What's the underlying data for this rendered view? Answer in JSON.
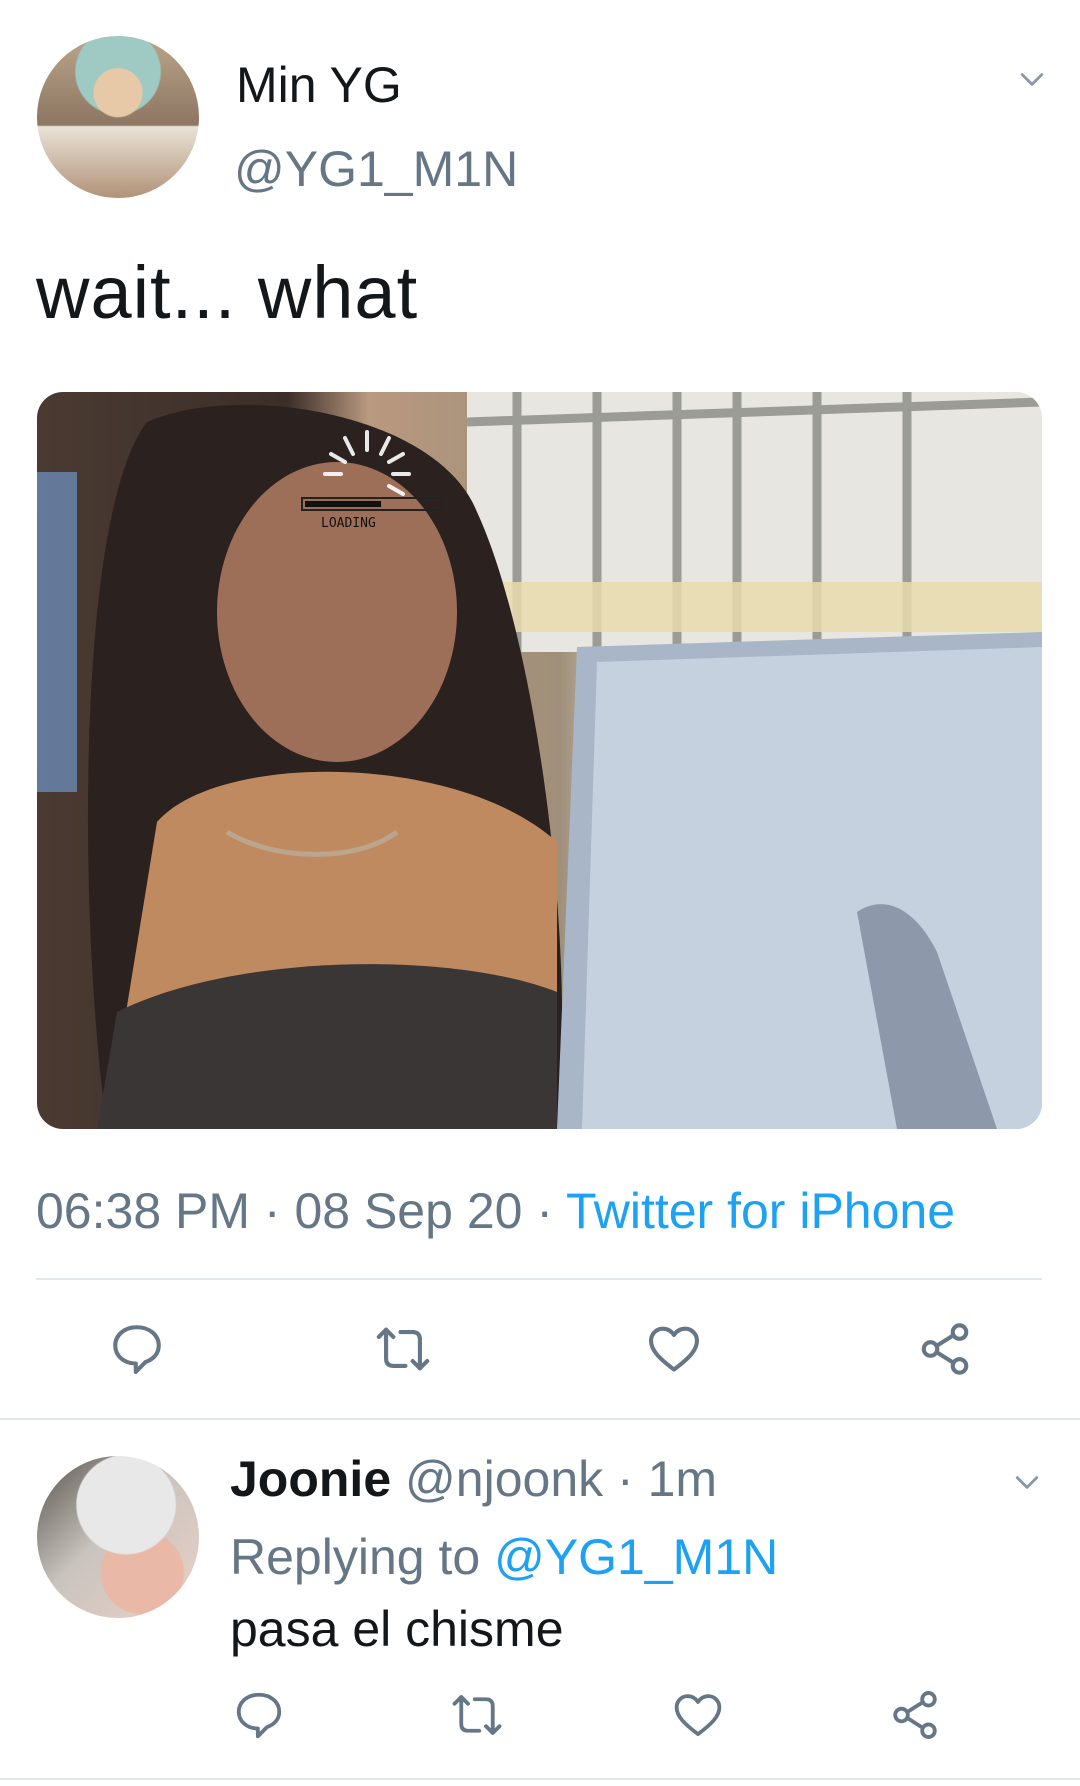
{
  "tweet": {
    "author_name": "Min YG",
    "author_handle": "@YG1_M1N",
    "text": "wait... what",
    "media_overlay_label": "LOADING",
    "time": "06:38 PM",
    "date": "08 Sep 20",
    "source": "Twitter for iPhone",
    "separator": " · "
  },
  "reply": {
    "author_name": "Joonie",
    "author_handle": "@njoonk",
    "age": "1m",
    "replying_prefix": "Replying to",
    "replying_to": "@YG1_M1N",
    "text": "pasa el chisme"
  },
  "icons": {
    "more": "chevron-down-icon",
    "reply": "comment-bubble-icon",
    "retweet": "retweet-icon",
    "like": "heart-icon",
    "share": "share-icon"
  },
  "colors": {
    "link": "#1da1f2",
    "secondary_text": "#657786",
    "divider": "#e1e8ed",
    "icon": "#657786"
  }
}
